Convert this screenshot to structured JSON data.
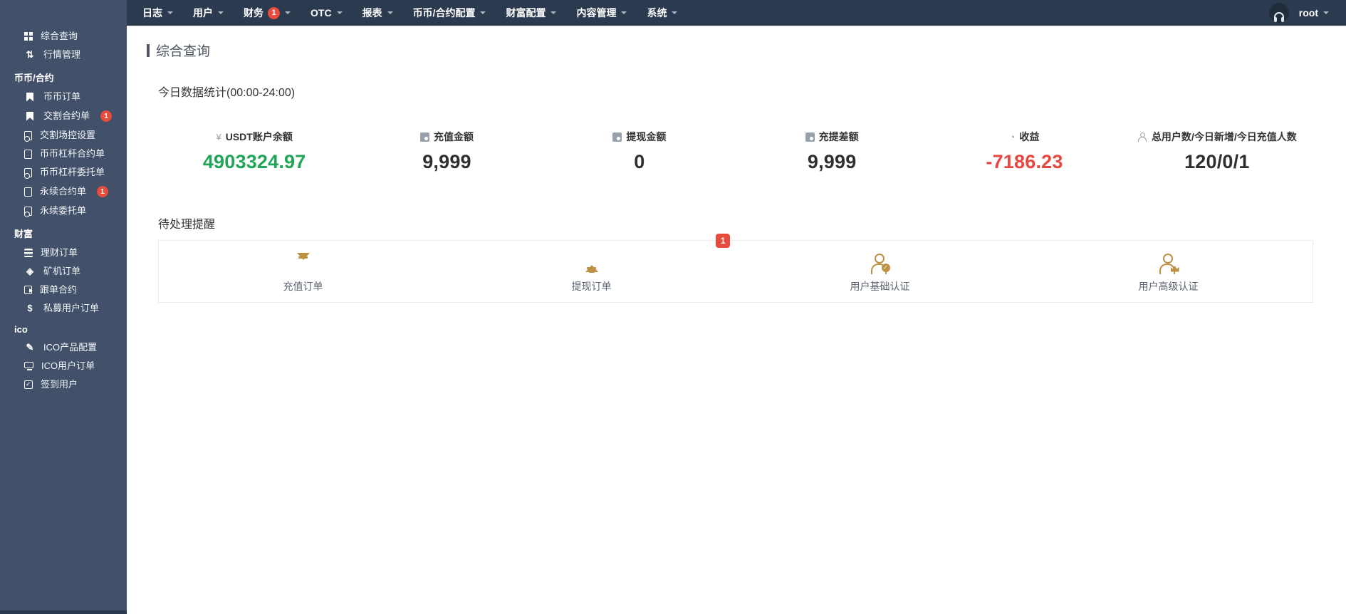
{
  "navbar": {
    "items": [
      {
        "label": "日志"
      },
      {
        "label": "用户"
      },
      {
        "label": "财务",
        "badge": "1"
      },
      {
        "label": "OTC"
      },
      {
        "label": "报表"
      },
      {
        "label": "币币/合约配置"
      },
      {
        "label": "财富配置"
      },
      {
        "label": "内容管理"
      },
      {
        "label": "系统"
      }
    ],
    "user": "root"
  },
  "sidebar": {
    "items": [
      {
        "label": "综合查询"
      },
      {
        "label": "行情管理"
      },
      {
        "label": "币币/合约"
      },
      {
        "label": "币币订单"
      },
      {
        "label": "交割合约单",
        "badge": "1"
      },
      {
        "label": "交割场控设置"
      },
      {
        "label": "币币杠杆合约单"
      },
      {
        "label": "币币杠杆委托单"
      },
      {
        "label": "永续合约单",
        "badge": "1"
      },
      {
        "label": "永续委托单"
      },
      {
        "label": "财富"
      },
      {
        "label": "理财订单"
      },
      {
        "label": "矿机订单"
      },
      {
        "label": "跟单合约"
      },
      {
        "label": "私募用户订单"
      },
      {
        "label": "ico"
      },
      {
        "label": "ICO产品配置"
      },
      {
        "label": "ICO用户订单"
      },
      {
        "label": "签到用户"
      }
    ]
  },
  "page": {
    "title": "综合查询"
  },
  "stats": {
    "title": "今日数据统计(00:00-24:00)",
    "items": [
      {
        "label": "USDT账户余额",
        "value": "4903324.97",
        "icon": "yen-icon"
      },
      {
        "label": "充值金额",
        "value": "9,999",
        "icon": "recharge-card-icon"
      },
      {
        "label": "提现金额",
        "value": "0",
        "icon": "withdraw-card-icon"
      },
      {
        "label": "充提差额",
        "value": "9,999",
        "icon": "diff-card-icon"
      },
      {
        "label": "收益",
        "value": "-7186.23",
        "icon": "profit-pie-icon"
      },
      {
        "label": "总用户数/今日新增/今日充值人数",
        "value": "120/0/1",
        "icon": "users-icon"
      }
    ]
  },
  "pending": {
    "title": "待处理提醒",
    "badge": "1",
    "cards": [
      {
        "label": "充值订单",
        "icon": "download-arrow-icon"
      },
      {
        "label": "提现订单",
        "icon": "upload-arrow-icon"
      },
      {
        "label": "用户基础认证",
        "icon": "user-check-icon"
      },
      {
        "label": "用户高级认证",
        "icon": "user-crown-icon"
      }
    ]
  },
  "colors": {
    "sidebar_bg": "#425069",
    "navbar_bg": "#2c3a4f",
    "positive_green": "#21a558",
    "negative_red": "#e8473f",
    "badge_red": "#e74c3c",
    "gold_icon": "#bd9142"
  }
}
